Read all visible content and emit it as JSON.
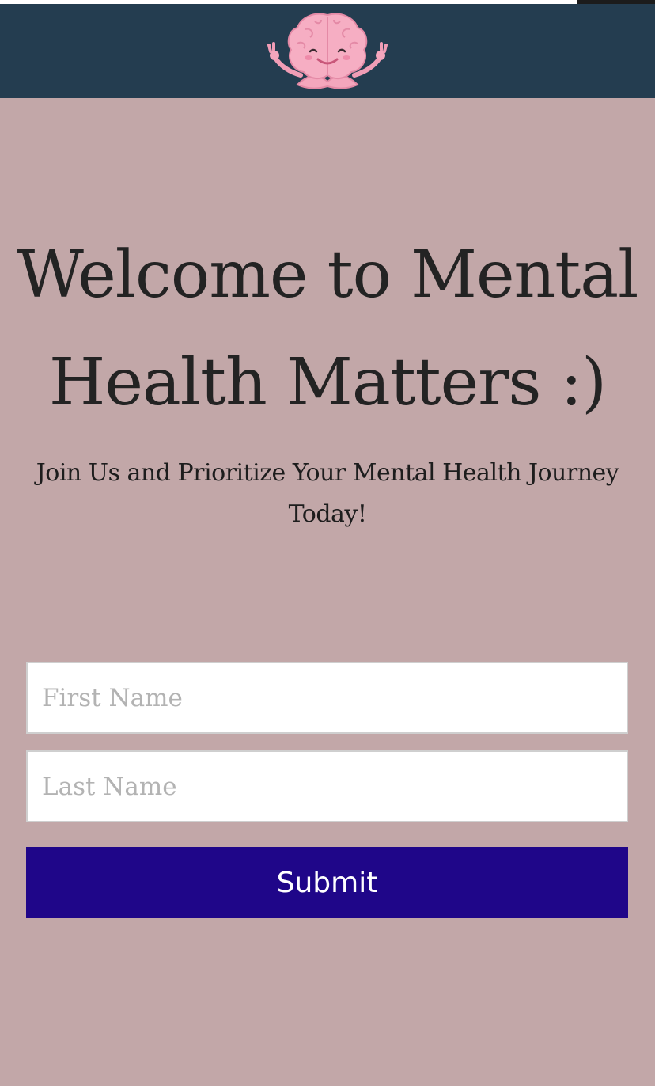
{
  "header": {
    "logo_icon": "meditating-brain-icon",
    "background_color": "#243d50"
  },
  "hero": {
    "title": "Welcome to Mental Health Matters :)",
    "subtitle": "Join Us and Prioritize Your Mental Health Journey Today!"
  },
  "form": {
    "first_name_placeholder": "First Name",
    "first_name_value": "",
    "last_name_placeholder": "Last Name",
    "last_name_value": "",
    "submit_label": "Submit",
    "submit_color": "#1f0689"
  },
  "page_loading_progress": 0.88,
  "colors": {
    "page_background": "#c2a7a8",
    "header_background": "#243d50",
    "button_background": "#1f0689",
    "brain_pink": "#f4a6bd"
  }
}
